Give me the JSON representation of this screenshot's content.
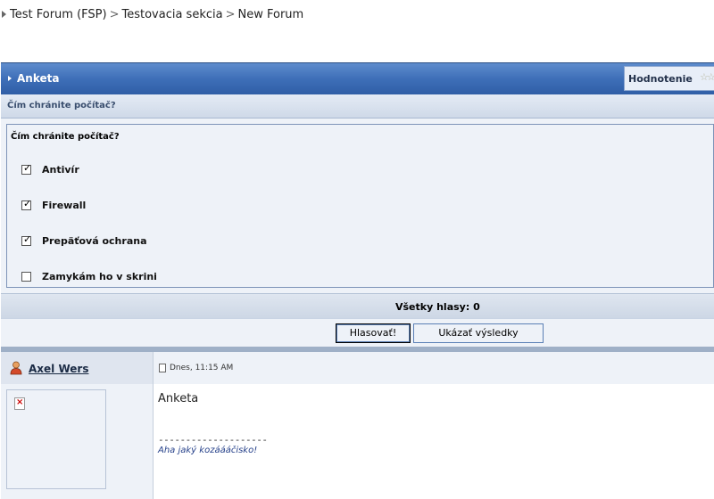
{
  "breadcrumb": [
    "Test Forum (FSP)",
    "Testovacia sekcia",
    "New Forum"
  ],
  "breadcrumb_sep": ">",
  "poll": {
    "title": "Anketa",
    "rating_label": "Hodnotenie",
    "question": "Čím chránite počítač?",
    "options": [
      {
        "label": "Antivír",
        "checked": true
      },
      {
        "label": "Firewall",
        "checked": true
      },
      {
        "label": "Prepäťová ochrana",
        "checked": true
      },
      {
        "label": "Zamykám ho v skrini",
        "checked": false
      }
    ],
    "total_votes": "Všetky hlasy: 0",
    "vote_button": "Hlasovať!",
    "results_button": "Ukázať výsledky"
  },
  "post": {
    "author": "Axel Wers",
    "date": "Dnes, 11:15 AM",
    "text": "Anketa",
    "signature_separator": "--------------------",
    "signature": "Aha jaký kozáááčisko!"
  },
  "colors": {
    "header_blue": "#3e6fb8",
    "light_bg": "#eef2f8",
    "signature_blue": "#26418a"
  },
  "icons": {
    "user": "user-icon",
    "post": "document-icon",
    "avatar": "broken-image-icon",
    "rating": "star-icon"
  }
}
